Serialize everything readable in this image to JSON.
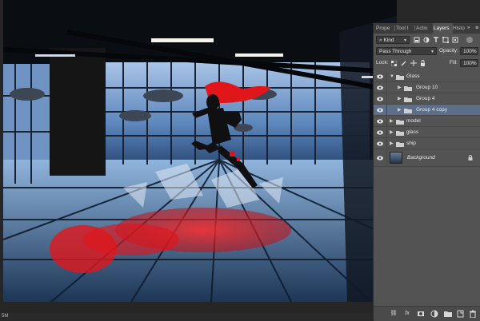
{
  "statusbar": {
    "zoom": "5M"
  },
  "layers_panel": {
    "tabs": [
      {
        "label": "Prope",
        "active": false
      },
      {
        "label": "Tool I",
        "active": false
      },
      {
        "label": "Actio",
        "active": false
      },
      {
        "label": "Layers",
        "active": true
      },
      {
        "label": "Histo",
        "active": false
      }
    ],
    "expand_glyph": "»",
    "menu_glyph": "≡",
    "filter": {
      "kind_label": "Kind",
      "search_glyph": "⌕"
    },
    "blend": {
      "mode": "Pass Through",
      "opacity_label": "Opacity:",
      "opacity_value": "100%"
    },
    "lock": {
      "label": "Lock:",
      "fill_label": "Fill:",
      "fill_value": "100%"
    },
    "layers": [
      {
        "name": "Glass",
        "type": "group",
        "expanded": true,
        "indent": 0,
        "selected": false
      },
      {
        "name": "Group 10",
        "type": "group",
        "expanded": false,
        "indent": 1,
        "selected": false
      },
      {
        "name": "Group 4",
        "type": "group",
        "expanded": false,
        "indent": 1,
        "selected": false
      },
      {
        "name": "Group 4 copy",
        "type": "group",
        "expanded": false,
        "indent": 1,
        "selected": true
      },
      {
        "name": "model",
        "type": "group",
        "expanded": false,
        "indent": 0,
        "selected": false
      },
      {
        "name": "glass",
        "type": "group",
        "expanded": false,
        "indent": 0,
        "selected": false
      },
      {
        "name": "ship",
        "type": "group",
        "expanded": false,
        "indent": 0,
        "selected": false
      },
      {
        "name": "Background",
        "type": "image",
        "locked": true,
        "indent": 0,
        "selected": false
      }
    ],
    "footer_icons": [
      "link-icon",
      "fx-icon",
      "mask-icon",
      "adjustment-icon",
      "folder-icon",
      "new-layer-icon",
      "trash-icon"
    ],
    "footer_glyphs": {
      "link": "⛓",
      "fx": "fx"
    }
  },
  "colors": {
    "selected_row": "#5c6f8a",
    "panel_bg": "#535353",
    "accent_red": "#e0161b"
  }
}
